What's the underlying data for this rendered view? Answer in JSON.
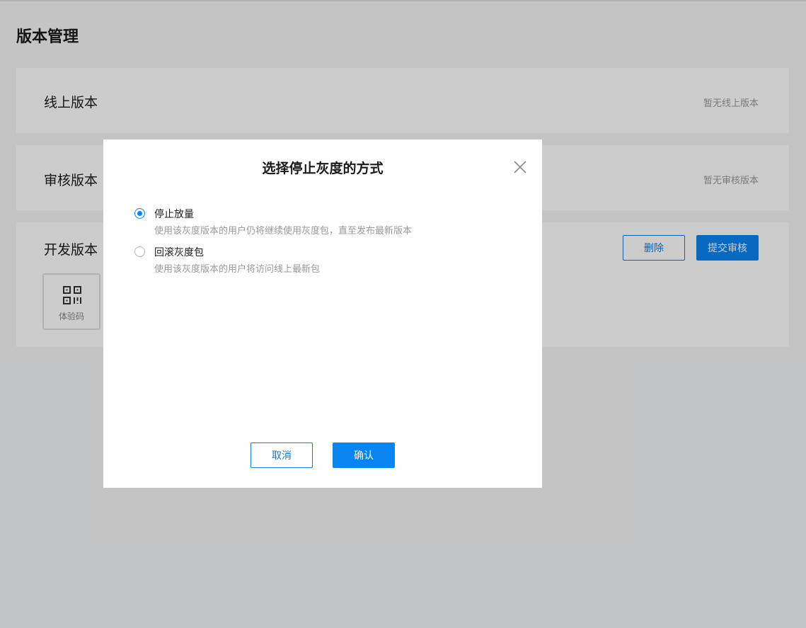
{
  "page": {
    "title": "版本管理"
  },
  "online": {
    "title": "线上版本",
    "empty_note": "暂无线上版本"
  },
  "review": {
    "title": "审核版本",
    "empty_note": "暂无审核版本"
  },
  "dev": {
    "title": "开发版本",
    "delete_label": "删除",
    "submit_label": "提交审核",
    "qr_label": "体验码",
    "qr_icon": "qr-code-icon"
  },
  "modal": {
    "title": "选择停止灰度的方式",
    "close_icon": "close-icon",
    "options": [
      {
        "label": "停止放量",
        "description": "使用该灰度版本的用户仍将继续使用灰度包，直至发布最新版本",
        "selected": true
      },
      {
        "label": "回滚灰度包",
        "description": "使用该灰度版本的用户将访问线上最新包",
        "selected": false
      }
    ],
    "cancel_label": "取消",
    "confirm_label": "确认"
  },
  "colors": {
    "accent": "#0a84f0",
    "text_primary": "#1a1a1a",
    "text_secondary": "#999999"
  }
}
